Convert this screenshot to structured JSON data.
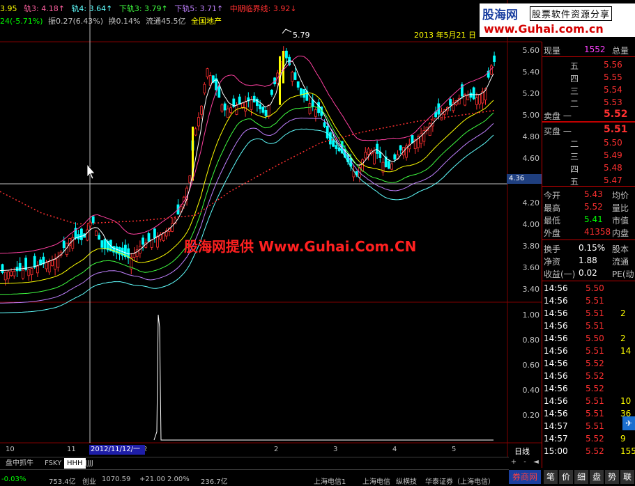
{
  "indicator": {
    "items": [
      {
        "text": "3.95",
        "color": "#ffff00"
      },
      {
        "text": "轨3: 4.18↑",
        "color": "#ff60a0"
      },
      {
        "text": "轨4: 3.64↑",
        "color": "#60ffff"
      },
      {
        "text": "下轨3: 3.79↑",
        "color": "#40ff40"
      },
      {
        "text": "下轨5: 3.71↑",
        "color": "#c080ff"
      },
      {
        "text": "中期临界线: 3.92↓",
        "color": "#ff3030"
      }
    ]
  },
  "info": {
    "items": [
      {
        "text": "24(-5.71%)",
        "color": "#00ff00"
      },
      {
        "text": "振0.27(6.43%)",
        "color": "#c0c0c0"
      },
      {
        "text": "换0.14%",
        "color": "#c0c0c0"
      },
      {
        "text": "流通45.5亿",
        "color": "#c0c0c0"
      },
      {
        "text": "全国地产",
        "color": "#ffff00"
      }
    ]
  },
  "logo": {
    "name": "股海网",
    "tag": "股票软件资源分享",
    "url": "www.Guhai.com.cn"
  },
  "date_label": "2013 年5月21 日",
  "peak_label": "5.79",
  "watermark": "股海网提供 Www.Guhai.Com.CN",
  "price_axis": [
    "5.60",
    "5.40",
    "5.20",
    "5.00",
    "4.80",
    "4.60",
    "4.20",
    "4.00",
    "3.80",
    "3.60",
    "3.40"
  ],
  "current_price_tag": "4.36",
  "volume_axis": [
    "1.00",
    "0.80",
    "0.60",
    "0.40",
    "0.20"
  ],
  "timeline": {
    "labels": [
      "10",
      "11",
      "2",
      "2",
      "3",
      "4",
      "5"
    ],
    "highlight": "2012/11/12/一",
    "timeframe": "日线"
  },
  "tabs": [
    {
      "label": "盘中抓牛",
      "active": false
    },
    {
      "label": "FSKY",
      "active": false
    },
    {
      "label": "HHH",
      "active": true
    },
    {
      "label": "JJJJ",
      "active": false
    }
  ],
  "zoom": {
    "plus": "+",
    "minus": "-",
    "left": "◄",
    "right": "►"
  },
  "status": [
    "-0.03%",
    "753.4亿",
    "创业",
    "1070.59",
    "+21.00",
    "2.00%",
    "236.7亿",
    "上海电信1",
    "上海电信",
    "纵横技",
    "华泰证券（上海电信）"
  ],
  "panel": {
    "header": {
      "label1": "现量",
      "value1": "1552",
      "label2": "总量"
    },
    "sell": [
      {
        "label": "五",
        "price": "5.56"
      },
      {
        "label": "四",
        "price": "5.55"
      },
      {
        "label": "三",
        "price": "5.54"
      },
      {
        "label": "二",
        "price": "5.53"
      },
      {
        "label": "卖盘 一",
        "price": "5.52"
      }
    ],
    "buy": [
      {
        "label": "买盘 一",
        "price": "5.51"
      },
      {
        "label": "二",
        "price": "5.50"
      },
      {
        "label": "三",
        "price": "5.49"
      },
      {
        "label": "四",
        "price": "5.48"
      },
      {
        "label": "五",
        "price": "5.47"
      }
    ],
    "stats": [
      {
        "l1": "今开",
        "v1": "5.43",
        "c1": "#ff3030",
        "l2": "均价"
      },
      {
        "l1": "最高",
        "v1": "5.52",
        "c1": "#ff3030",
        "l2": "量比"
      },
      {
        "l1": "最低",
        "v1": "5.41",
        "c1": "#00ff00",
        "l2": "市值"
      },
      {
        "l1": "外盘",
        "v1": "41358",
        "c1": "#ff3030",
        "l2": "内盘"
      }
    ],
    "stats2": [
      {
        "l1": "换手",
        "v1": "0.15%",
        "l2": "股本"
      },
      {
        "l1": "净资",
        "v1": "1.88",
        "l2": "流通"
      },
      {
        "l1": "收益(一)",
        "v1": "0.02",
        "l2": "PE(动"
      }
    ],
    "ticks": [
      {
        "time": "14:56",
        "price": "5.50",
        "vol": ""
      },
      {
        "time": "14:56",
        "price": "5.51",
        "vol": ""
      },
      {
        "time": "14:56",
        "price": "5.51",
        "vol": "2"
      },
      {
        "time": "14:56",
        "price": "5.51",
        "vol": ""
      },
      {
        "time": "14:56",
        "price": "5.50",
        "vol": "2"
      },
      {
        "time": "14:56",
        "price": "5.51",
        "vol": "14"
      },
      {
        "time": "14:56",
        "price": "5.52",
        "vol": ""
      },
      {
        "time": "14:56",
        "price": "5.52",
        "vol": ""
      },
      {
        "time": "14:56",
        "price": "5.52",
        "vol": ""
      },
      {
        "time": "14:56",
        "price": "5.51",
        "vol": "10"
      },
      {
        "time": "14:56",
        "price": "5.51",
        "vol": "36"
      },
      {
        "time": "14:57",
        "price": "5.51",
        "vol": ""
      },
      {
        "time": "14:57",
        "price": "5.52",
        "vol": "9"
      },
      {
        "time": "15:00",
        "price": "5.52",
        "vol": "155"
      }
    ]
  },
  "bottom_tabs": [
    "券商网",
    "笔",
    "价",
    "细",
    "盘",
    "势",
    "联"
  ],
  "colors": {
    "up": "#ff3030",
    "down": "#00ffff",
    "panel_border": "#c00000",
    "brand_blue": "#1a3fa0"
  }
}
